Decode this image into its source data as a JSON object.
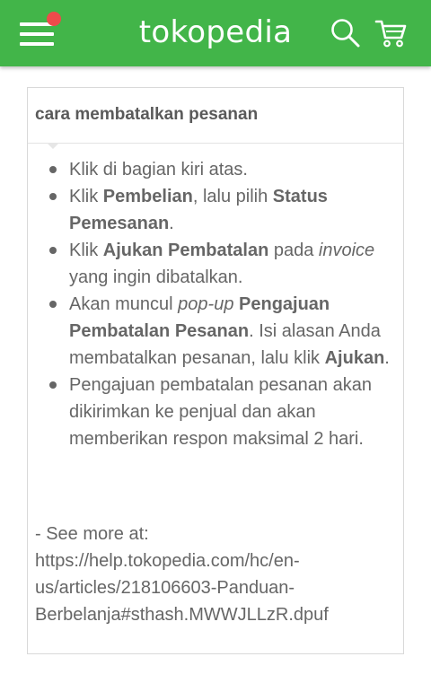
{
  "header": {
    "logo_text": "tokopedia",
    "brand_color": "#42b549",
    "notification_color": "#ef4b4b",
    "icons": [
      "menu-icon",
      "notification-dot-icon",
      "search-icon",
      "cart-icon"
    ]
  },
  "article": {
    "title": "cara membatalkan pesanan",
    "steps": [
      {
        "parts": [
          {
            "t": "Klik   di bagian kiri atas."
          }
        ]
      },
      {
        "parts": [
          {
            "t": "Klik "
          },
          {
            "t": "Pembelian",
            "b": true
          },
          {
            "t": ", lalu pilih "
          },
          {
            "t": "Status Pemesanan",
            "b": true
          },
          {
            "t": "."
          }
        ]
      },
      {
        "parts": [
          {
            "t": "Klik "
          },
          {
            "t": "Ajukan Pembatalan",
            "b": true
          },
          {
            "t": " pada "
          },
          {
            "t": "invoice",
            "i": true
          },
          {
            "t": " yang ingin dibatalkan."
          }
        ]
      },
      {
        "parts": [
          {
            "t": "Akan muncul "
          },
          {
            "t": "pop-up",
            "i": true
          },
          {
            "t": " "
          },
          {
            "t": "Pengajuan Pembatalan Pesanan",
            "b": true
          },
          {
            "t": ". Isi alasan Anda membatalkan pesanan, lalu klik "
          },
          {
            "t": "Ajukan",
            "b": true
          },
          {
            "t": "."
          }
        ]
      },
      {
        "parts": [
          {
            "t": "Pengajuan pembatalan pesanan akan dikirimkan ke penjual dan akan memberikan respon maksimal 2 hari."
          }
        ]
      }
    ],
    "see_more": {
      "label": "- See more at:",
      "url_lines": [
        "https://help.tokopedia.com/hc/en-",
        "us/articles/218106603-Panduan-",
        "Berbelanja#sthash.MWWJLLzR.dpuf"
      ]
    }
  }
}
